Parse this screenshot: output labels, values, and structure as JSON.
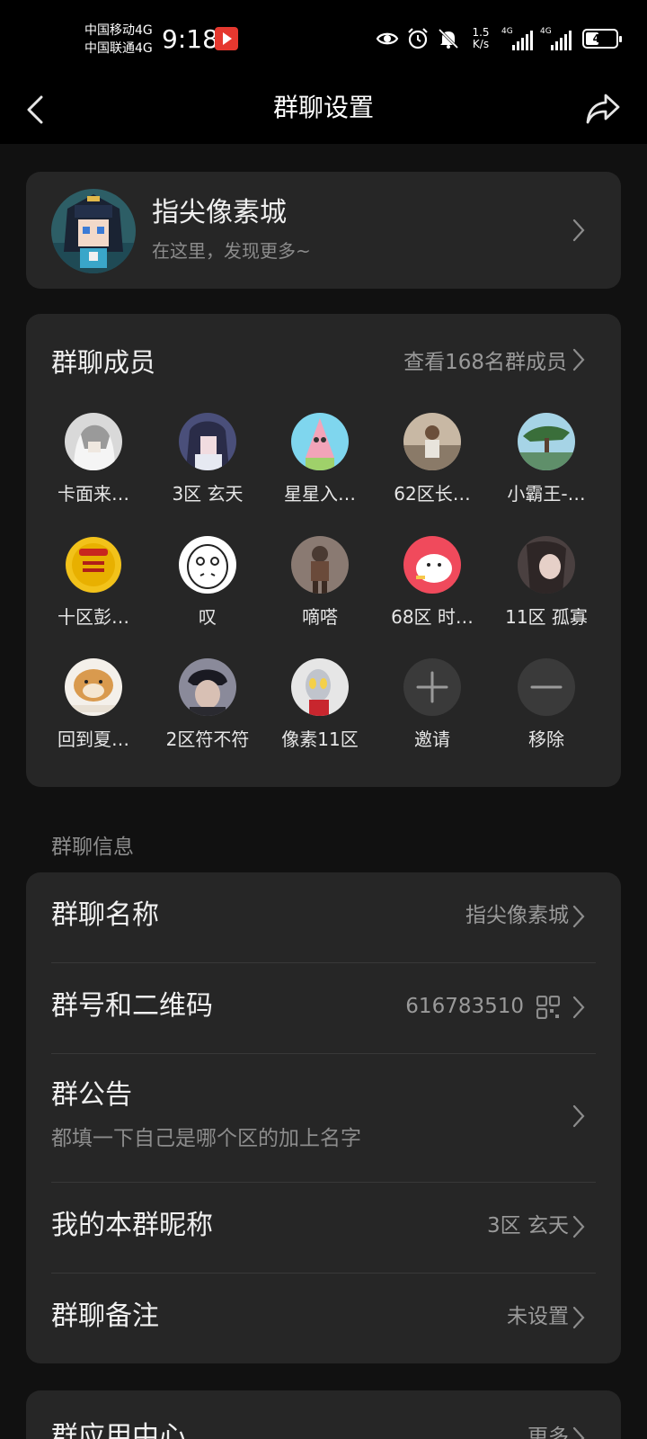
{
  "status_bar": {
    "carrier_1": "中国移动4G",
    "carrier_2": "中国联通4G",
    "time": "9:18",
    "speed_1": "1.5",
    "speed_2": "K/s",
    "sig_label": "4G",
    "battery": "44",
    "battery_level": 0.44
  },
  "header": {
    "title": "群聊设置"
  },
  "group": {
    "name": "指尖像素城",
    "subtitle": "在这里，发现更多~"
  },
  "members": {
    "title": "群聊成员",
    "view_all": "查看168名群成员",
    "list": [
      {
        "name": "卡面来…"
      },
      {
        "name": "3区 玄天"
      },
      {
        "name": "星星入…"
      },
      {
        "name": "62区长…"
      },
      {
        "name": "小霸王-…"
      },
      {
        "name": "十区彭…"
      },
      {
        "name": "叹"
      },
      {
        "name": "嘀嗒"
      },
      {
        "name": "68区 时…"
      },
      {
        "name": "11区 孤寡"
      },
      {
        "name": "回到夏…"
      },
      {
        "name": "2区符不符"
      },
      {
        "name": "像素11区"
      }
    ],
    "invite_label": "邀请",
    "remove_label": "移除"
  },
  "info": {
    "section_label": "群聊信息",
    "group_name_label": "群聊名称",
    "group_name_value": "指尖像素城",
    "group_number_label": "群号和二维码",
    "group_number_value": "616783510",
    "notice_label": "群公告",
    "notice_text": "都填一下自己是哪个区的加上名字",
    "nickname_label": "我的本群昵称",
    "nickname_value": "3区 玄天",
    "remark_label": "群聊备注",
    "remark_value": "未设置"
  },
  "apps": {
    "title": "群应用中心",
    "more": "更多"
  }
}
